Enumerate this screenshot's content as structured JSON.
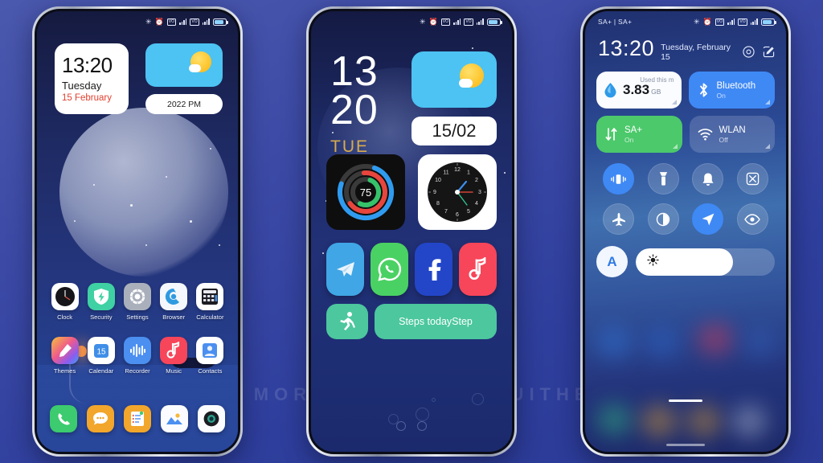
{
  "watermark": "VISIT  FOR  MORE  THEMES  -  MIUITHEMER.COM",
  "phone1": {
    "statusbar": {
      "bluetooth": "bluetooth-icon",
      "alarm": "alarm-icon",
      "sim1": "VO",
      "sim2": "VO",
      "net": "4G"
    },
    "clock_widget": {
      "time": "13:20",
      "day": "Tuesday",
      "date": "15 February"
    },
    "weather_widget": {
      "icon": "sun-cloud-icon"
    },
    "pill_widget": {
      "label": "2022 PM"
    },
    "apps_row1": [
      {
        "label": "Clock",
        "icon": "clock-icon"
      },
      {
        "label": "Security",
        "icon": "shield-icon"
      },
      {
        "label": "Settings",
        "icon": "gear-icon"
      },
      {
        "label": "Browser",
        "icon": "browser-icon"
      },
      {
        "label": "Calculator",
        "icon": "calculator-icon"
      }
    ],
    "apps_row2": [
      {
        "label": "Themes",
        "icon": "themes-brush-icon"
      },
      {
        "label": "Calendar",
        "icon": "calendar-icon",
        "day": "15"
      },
      {
        "label": "Recorder",
        "icon": "recorder-icon"
      },
      {
        "label": "Music",
        "icon": "music-note-icon"
      },
      {
        "label": "Contacts",
        "icon": "contacts-icon"
      }
    ],
    "dock": [
      {
        "name": "Phone",
        "icon": "phone-icon"
      },
      {
        "name": "Messages",
        "icon": "message-icon"
      },
      {
        "name": "Notes",
        "icon": "notes-icon"
      },
      {
        "name": "Gallery",
        "icon": "gallery-icon"
      },
      {
        "name": "Camera",
        "icon": "camera-icon"
      }
    ]
  },
  "phone2": {
    "time_hour": "13",
    "time_minute": "20",
    "weekday": "TUE",
    "weekday_color": "#d8ab4e",
    "date_card": "15/02",
    "rings_widget": {
      "value": "75",
      "ring_colors": [
        "#2f9bf0",
        "#e8453c",
        "#36c26a"
      ]
    },
    "analog_clock": {
      "numerals": [
        "12",
        "1",
        "2",
        "3",
        "4",
        "5",
        "6",
        "7",
        "8",
        "9",
        "10",
        "11"
      ]
    },
    "apps": [
      {
        "name": "Telegram",
        "icon": "telegram-icon",
        "color": "#41a6e6"
      },
      {
        "name": "WhatsApp",
        "icon": "whatsapp-icon",
        "color": "#4ad163"
      },
      {
        "name": "Facebook",
        "icon": "facebook-icon",
        "color": "#2346c8"
      },
      {
        "name": "Music",
        "icon": "music-note-icon",
        "color": "#f7455a"
      }
    ],
    "steps_widget": {
      "icon": "running-icon",
      "label": "Steps todayStep"
    }
  },
  "phone3": {
    "statusbar_left": "SA+ | SA+",
    "time": "13:20",
    "date": "Tuesday, February 15",
    "header_icons": [
      "settings-gear-icon",
      "edit-icon"
    ],
    "data_card": {
      "icon": "data-drop-icon",
      "caption": "Used this m",
      "value": "3.83",
      "unit": "GB"
    },
    "tiles": [
      {
        "title": "Bluetooth",
        "sub": "On",
        "icon": "bluetooth-icon",
        "color": "#3f89f5",
        "active": true
      },
      {
        "title": "SA+",
        "sub": "On",
        "icon": "data-arrows-icon",
        "color": "#4cc96b",
        "active": true
      },
      {
        "title": "WLAN",
        "sub": "Off",
        "icon": "wifi-icon",
        "color": "rgba(255,255,255,0.16)",
        "active": false
      }
    ],
    "toggles": [
      {
        "name": "vibration",
        "icon": "vibration-icon",
        "active": true
      },
      {
        "name": "flashlight",
        "icon": "flashlight-icon",
        "active": false
      },
      {
        "name": "ringer",
        "icon": "bell-icon",
        "active": false
      },
      {
        "name": "screenshot",
        "icon": "screenshot-icon",
        "active": false
      },
      {
        "name": "airplane-mode",
        "icon": "airplane-icon",
        "active": false
      },
      {
        "name": "dark-mode",
        "icon": "contrast-icon",
        "active": false
      },
      {
        "name": "location",
        "icon": "location-arrow-icon",
        "active": true
      },
      {
        "name": "reading-mode",
        "icon": "eye-icon",
        "active": false
      }
    ],
    "brightness": {
      "auto_label": "A",
      "icon": "brightness-sun-icon",
      "value": 70
    }
  }
}
